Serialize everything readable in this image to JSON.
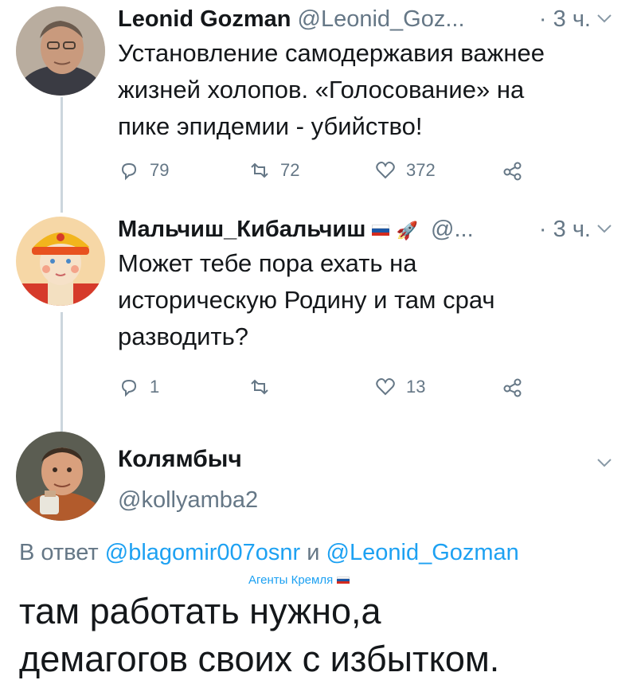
{
  "colors": {
    "link": "#1da1f2",
    "muted": "#657786",
    "text": "#14171a",
    "thread": "#ccd6dd"
  },
  "tweets": [
    {
      "name": "Leonid Gozman",
      "handle": "@Leonid_Goz...",
      "time": "· 3 ч.",
      "lines": [
        "Установление самодержавия важнее",
        "жизней холопов. «Голосование» на",
        "пике эпидемии - убийство!"
      ],
      "actions": {
        "reply": "79",
        "retweet": "72",
        "like": "372"
      }
    },
    {
      "name": "Мальчиш_Кибальчиш",
      "name_emoji": "🚀",
      "handle": "@...",
      "time": "· 3 ч.",
      "lines": [
        "Может тебе пора ехать на",
        "историческую Родину и там срач",
        "разводить?"
      ],
      "actions": {
        "reply": "1",
        "retweet": "",
        "like": "13"
      }
    }
  ],
  "main": {
    "name": "Колямбыч",
    "handle": "@kollyamba2",
    "reply_prefix": "В ответ",
    "reply_to_1": "@blagomir007osnr",
    "reply_and": "и",
    "reply_to_2": "@Leonid_Gozman",
    "flair": "Агенты Кремля",
    "lines": [
      "там работать нужно,а",
      "демагогов своих с избытком."
    ]
  },
  "icons": [
    "reply-icon",
    "retweet-icon",
    "like-icon",
    "share-icon",
    "chevron-down-icon"
  ]
}
